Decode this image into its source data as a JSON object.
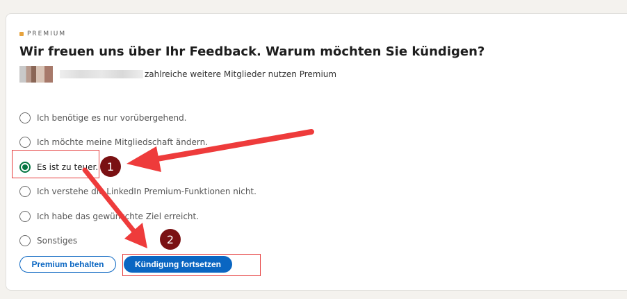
{
  "badge_label": "PREMIUM",
  "title": "Wir freuen uns über Ihr Feedback. Warum möchten Sie kündigen?",
  "members_text": "zahlreiche weitere Mitglieder nutzen Premium",
  "options": [
    {
      "label": "Ich benötige es nur vorübergehend.",
      "checked": false
    },
    {
      "label": "Ich möchte meine Mitgliedschaft ändern.",
      "checked": false
    },
    {
      "label": "Es ist zu teuer.",
      "checked": true
    },
    {
      "label": "Ich verstehe die LinkedIn Premium-Funktionen nicht.",
      "checked": false
    },
    {
      "label": "Ich habe das gewünschte Ziel erreicht.",
      "checked": false
    },
    {
      "label": "Sonstiges",
      "checked": false
    }
  ],
  "buttons": {
    "keep": "Premium behalten",
    "cancel": "Kündigung fortsetzen"
  },
  "annotations": {
    "step1": "1",
    "step2": "2"
  },
  "colors": {
    "accent": "#0a66c2",
    "radio_selected": "#057642",
    "annotation": "#e53b3b",
    "badge": "#7a1113"
  }
}
